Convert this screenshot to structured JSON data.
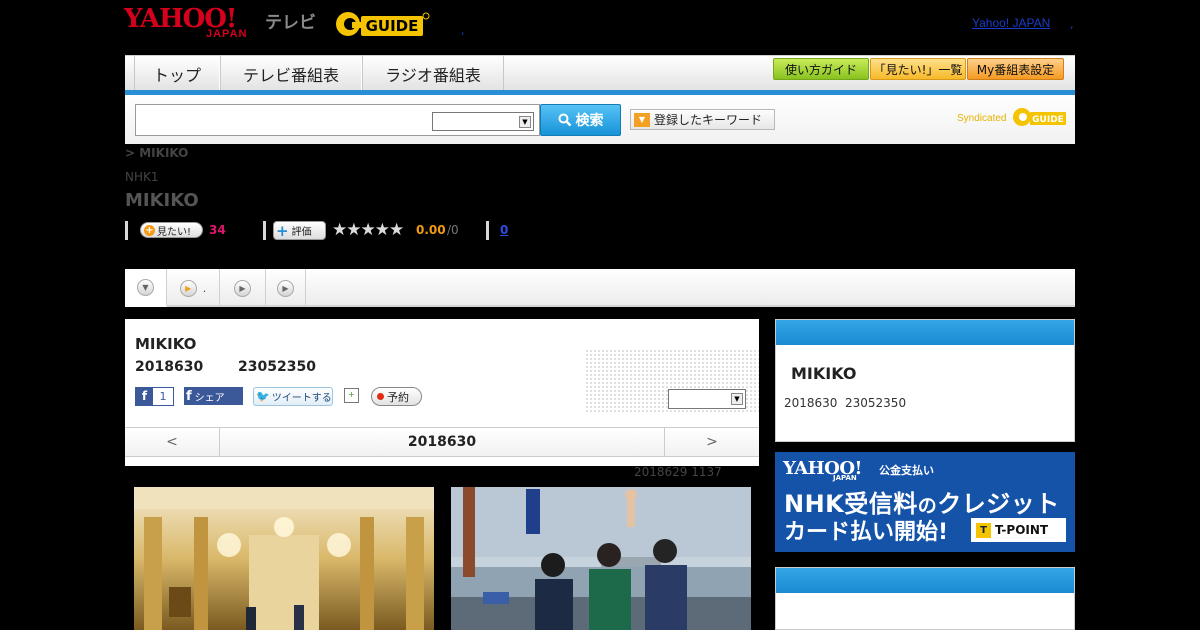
{
  "header": {
    "logo_yahoo": "YAHOO!",
    "logo_japan": "JAPAN",
    "logo_tv": "テレビ",
    "logo_gguide": "G-GUIDE",
    "yahoo_link": "Yahoo! JAPAN",
    "sep1": ",",
    "sep2": ","
  },
  "nav": {
    "tabs": [
      "トップ",
      "テレビ番組表",
      "ラジオ番組表"
    ],
    "buttons": [
      "使い方ガイド",
      "「見たい!」一覧",
      "My番組表設定"
    ]
  },
  "search": {
    "input_value": "",
    "select_value": "",
    "button_label": "検索",
    "keyword_button": "登録したキーワード",
    "syndicated": "Syndicated"
  },
  "program": {
    "breadcrumb": "> MIKIKO",
    "channel": "NHK1",
    "title": "MIKIKO",
    "want_label": "見たい!",
    "want_count": "34",
    "rate_label": "評価",
    "stars": "★★★★★",
    "rating": "0.00",
    "rating_max": "/0",
    "review_count": "0"
  },
  "tabs": [
    {
      "icon": "▼"
    },
    {
      "icon": "▶",
      "label": "."
    },
    {
      "icon": "▶"
    },
    {
      "icon": "▶"
    }
  ],
  "detail": {
    "title": "MIKIKO",
    "date": "2018630",
    "time": "23052350",
    "fb_like_count": "1",
    "fb_share": "シェア",
    "tweet": "ツイートする",
    "reserve": "予約",
    "select_value": "",
    "prev": "<",
    "next": ">",
    "nav_date": "2018630",
    "updated": "2018629  1137"
  },
  "side": {
    "title": "MIKIKO",
    "date": "2018630",
    "time": "23052350"
  },
  "banner": {
    "logo": "YAHOO!",
    "logo_sub": "JAPAN",
    "service": "公金支払い",
    "line1a": "NHK受信料",
    "line1b": "の",
    "line1c": "クレジット",
    "line2": "カード払い開始!",
    "tpoint": "T-POINT",
    "tpoint_mark": "T"
  },
  "colors": {
    "accent_blue": "#2a8ed6",
    "yahoo_red": "#d6001c",
    "want_pink": "#e0176a",
    "rating_orange": "#f29a10",
    "banner_blue": "#1553a8"
  }
}
